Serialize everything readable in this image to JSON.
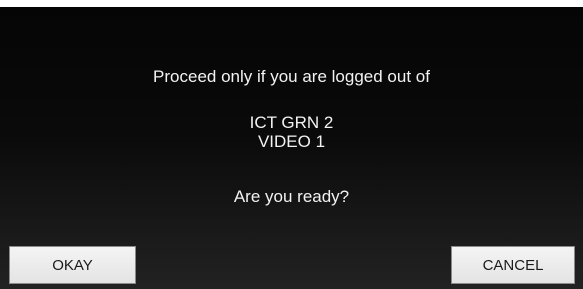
{
  "dialog": {
    "intro": "Proceed only if you are logged out of",
    "targets": [
      "ICT GRN 2",
      "VIDEO 1"
    ],
    "question": "Are you ready?",
    "okay_label": "OKAY",
    "cancel_label": "CANCEL"
  }
}
